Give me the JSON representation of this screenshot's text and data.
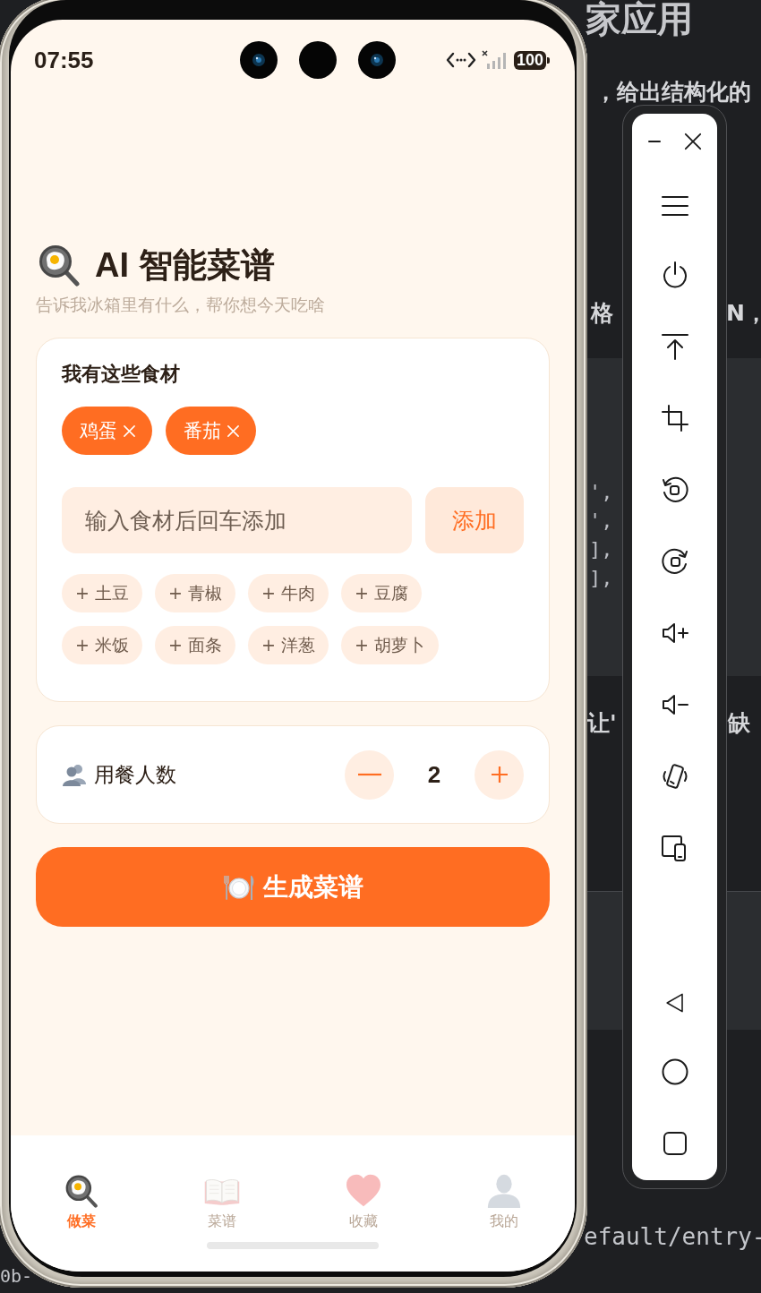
{
  "editor": {
    "heading": "家应用",
    "text_lines": [
      [
        "，给出结构化的"
      ],
      [
        "格",
        "N，"
      ]
    ],
    "code_lines": [
      "',",
      "',",
      "],",
      "],"
    ],
    "text_lines_2": [
      [
        "让'",
        "缺"
      ]
    ],
    "footer_lines": [
      "efault/entry-",
      "0b-"
    ]
  },
  "phone": {
    "status_bar": {
      "time": "07:55",
      "battery": "100"
    },
    "header": {
      "title": "AI 智能菜谱",
      "subtitle": "告诉我冰箱里有什么，帮你想今天吃啥"
    },
    "ingredients_card": {
      "heading": "我有这些食材",
      "selected": [
        {
          "label": "鸡蛋"
        },
        {
          "label": "番茄"
        }
      ],
      "input": {
        "placeholder": "输入食材后回车添加"
      },
      "add_button": "添加",
      "suggestions": [
        "+ 土豆",
        "+ 青椒",
        "+ 牛肉",
        "+ 豆腐",
        "+ 米饭",
        "+ 面条",
        "+ 洋葱",
        "+ 胡萝卜"
      ]
    },
    "servings": {
      "label": "用餐人数",
      "value": "2"
    },
    "generate_button": "生成菜谱",
    "tabs": [
      {
        "label": "做菜",
        "selected": true
      },
      {
        "label": "菜谱",
        "selected": false
      },
      {
        "label": "收藏",
        "selected": false
      },
      {
        "label": "我的",
        "selected": false
      }
    ]
  }
}
